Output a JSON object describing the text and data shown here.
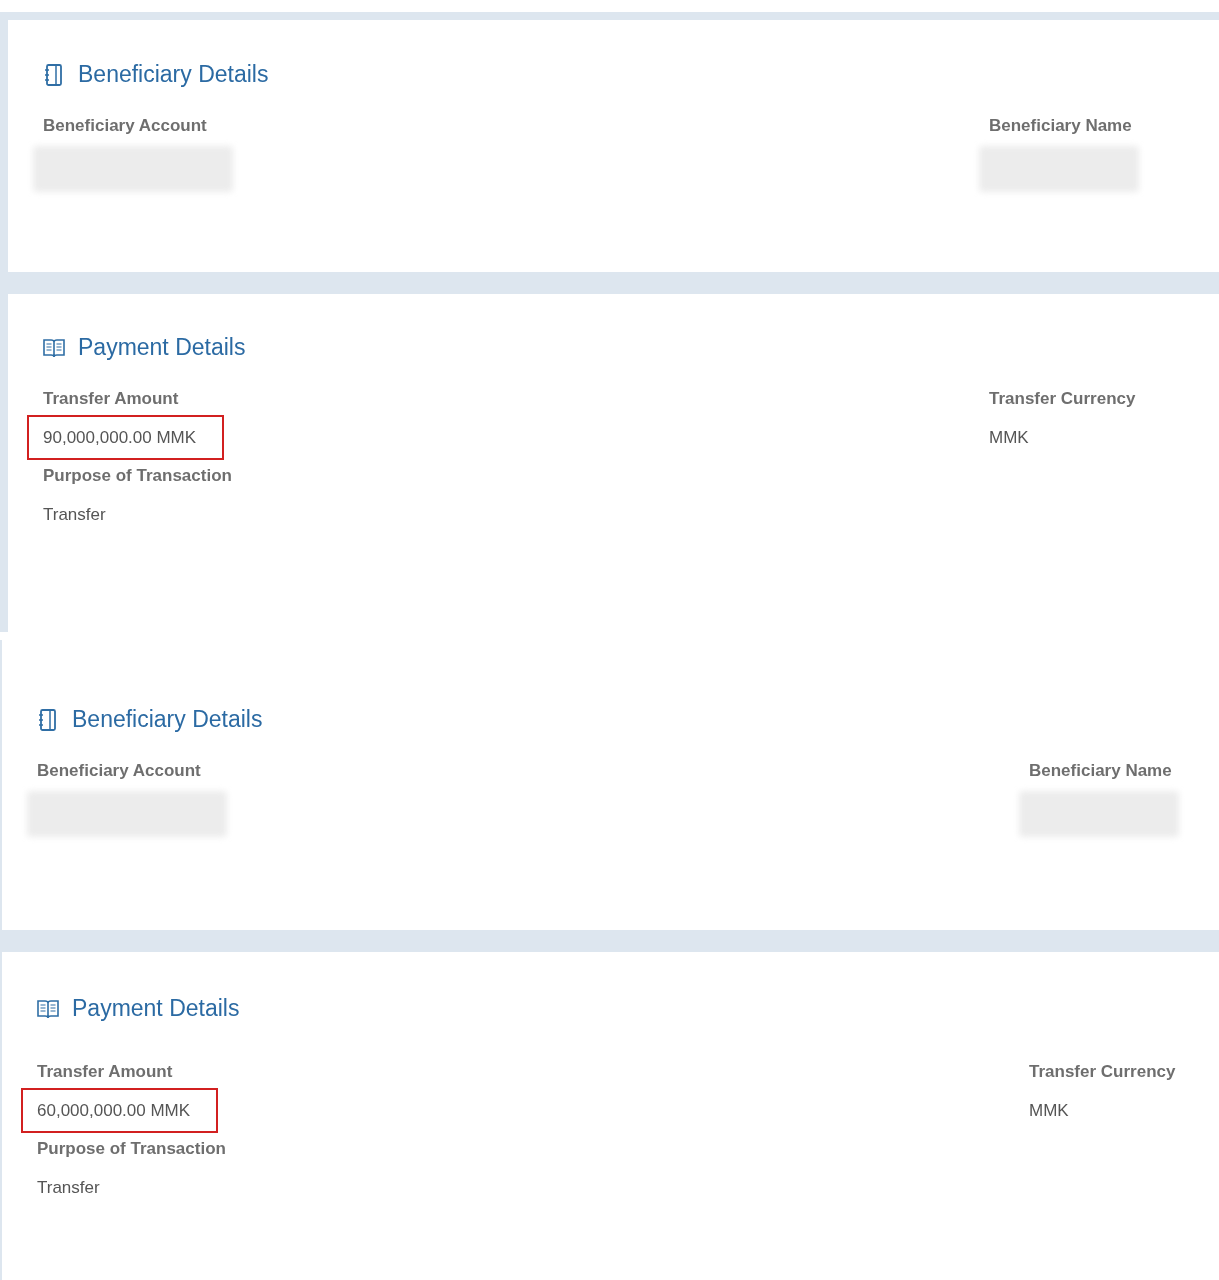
{
  "screenshots": [
    {
      "sections": [
        {
          "kind": "beneficiary",
          "title": "Beneficiary Details",
          "left": [
            {
              "label": "Beneficiary Account",
              "redacted": true
            }
          ],
          "right": [
            {
              "label": "Beneficiary Name",
              "redacted": true
            }
          ]
        },
        {
          "kind": "payment",
          "title": "Payment Details",
          "left": [
            {
              "label": "Transfer Amount",
              "value": "90,000,000.00 MMK",
              "redacted": false,
              "highlighted": true
            },
            {
              "label": "Purpose of Transaction",
              "value": "Transfer",
              "redacted": false,
              "highlighted": false
            }
          ],
          "right": [
            {
              "label": "Transfer Currency",
              "value": "MMK",
              "redacted": false,
              "highlighted": false
            }
          ]
        }
      ]
    },
    {
      "sections": [
        {
          "kind": "beneficiary",
          "title": "Beneficiary Details",
          "left": [
            {
              "label": "Beneficiary Account",
              "redacted": true
            }
          ],
          "right": [
            {
              "label": "Beneficiary Name",
              "redacted": true
            }
          ]
        },
        {
          "kind": "payment",
          "title": "Payment Details",
          "left": [
            {
              "label": "Transfer Amount",
              "value": "60,000,000.00 MMK",
              "redacted": false,
              "highlighted": true
            },
            {
              "label": "Purpose of Transaction",
              "value": "Transfer",
              "redacted": false,
              "highlighted": false
            }
          ],
          "right": [
            {
              "label": "Transfer Currency",
              "value": "MMK",
              "redacted": false,
              "highlighted": false
            }
          ]
        }
      ]
    }
  ]
}
